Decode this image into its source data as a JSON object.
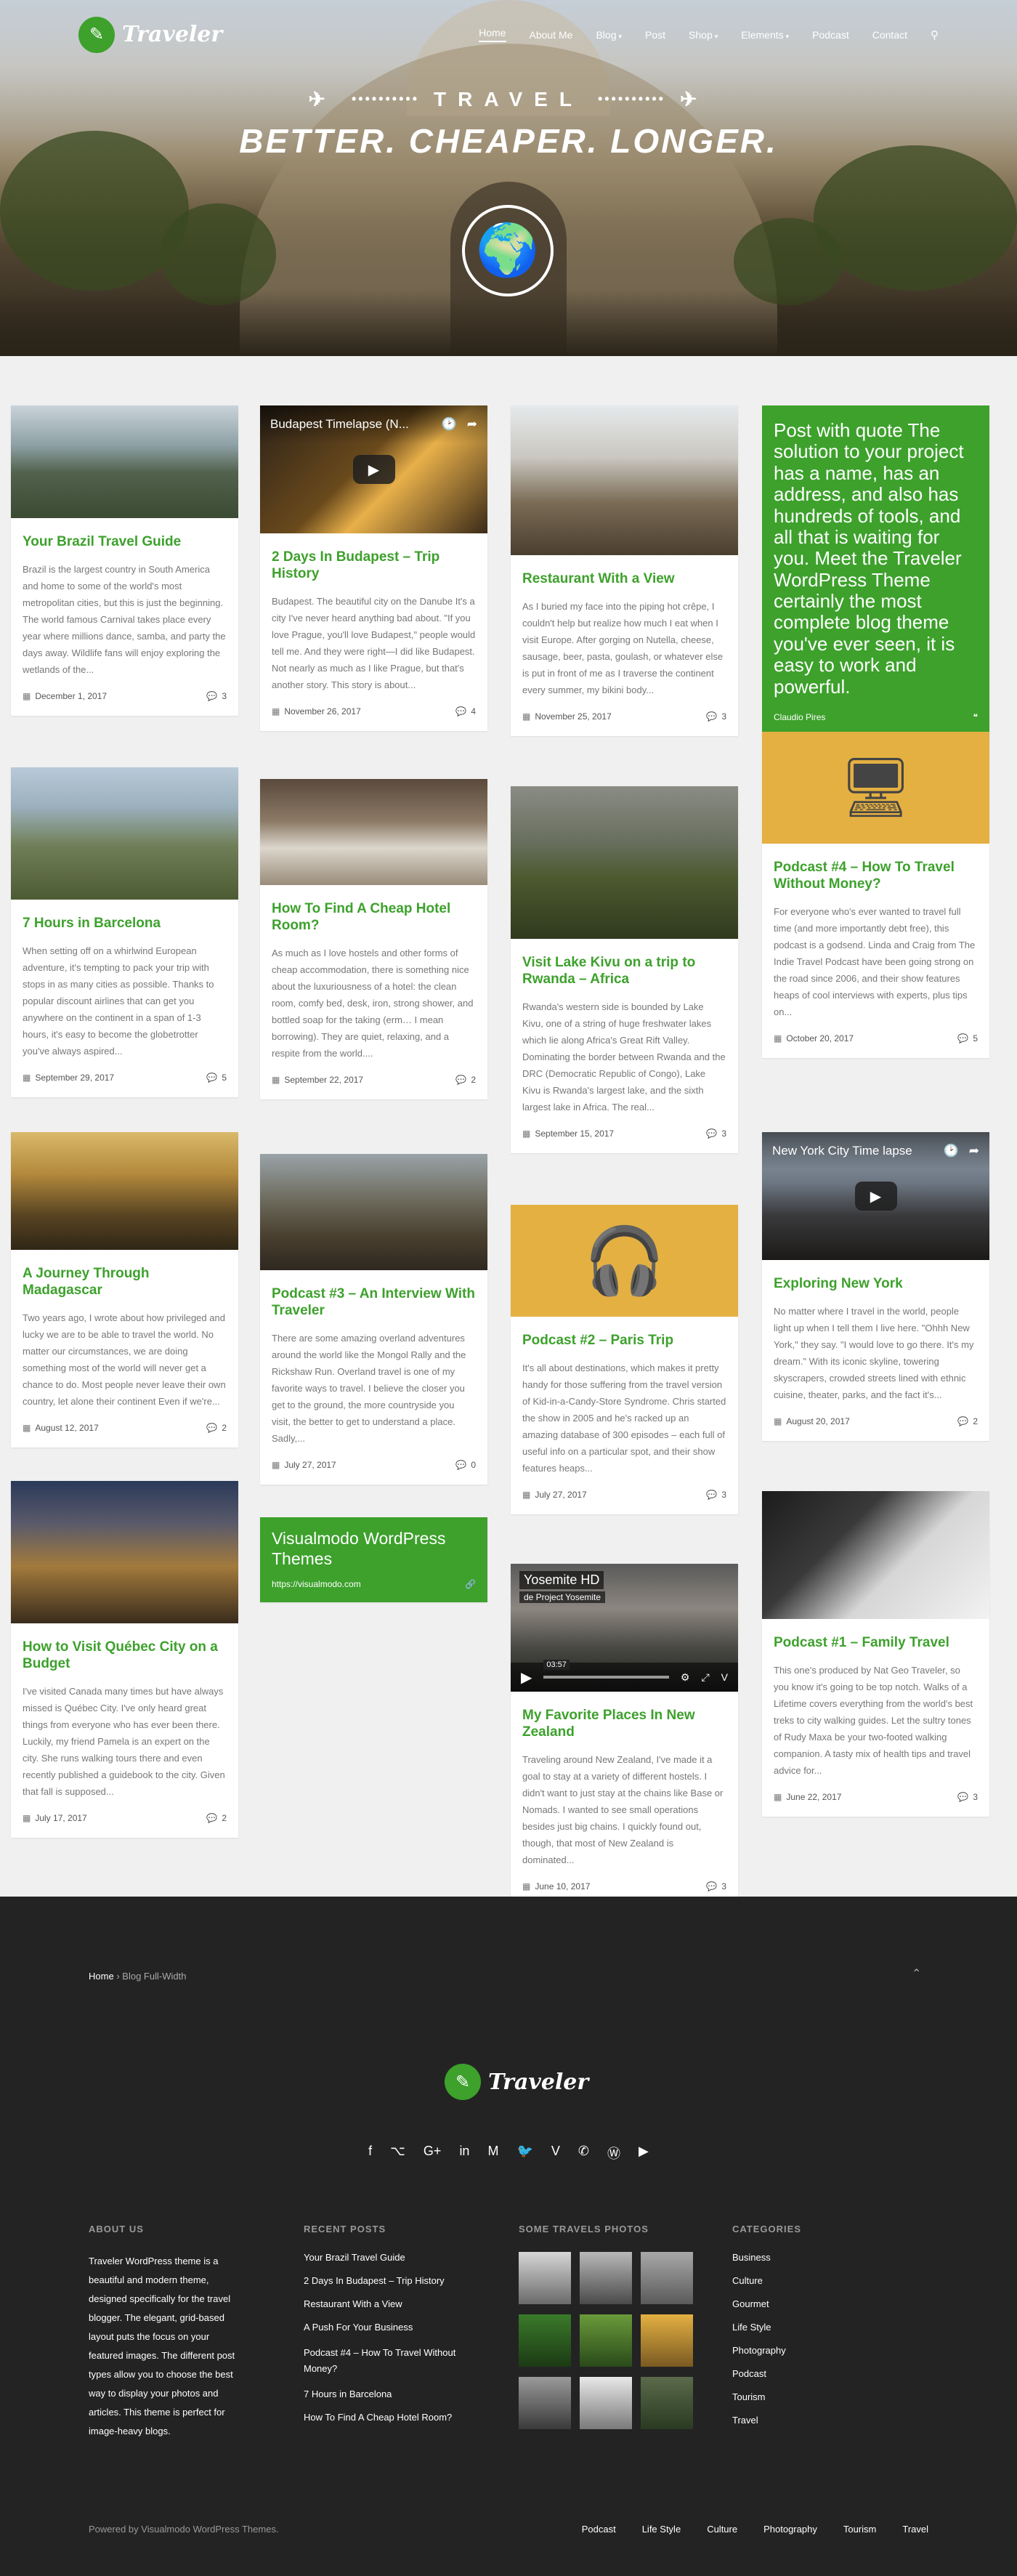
{
  "site": {
    "logo_text": "Traveler",
    "accent": "#3da12c"
  },
  "nav": {
    "items": [
      {
        "label": "Home",
        "active": true,
        "dropdown": false
      },
      {
        "label": "About Me",
        "active": false,
        "dropdown": false
      },
      {
        "label": "Blog",
        "active": false,
        "dropdown": true
      },
      {
        "label": "Post",
        "active": false,
        "dropdown": false
      },
      {
        "label": "Shop",
        "active": false,
        "dropdown": true
      },
      {
        "label": "Elements",
        "active": false,
        "dropdown": true
      },
      {
        "label": "Podcast",
        "active": false,
        "dropdown": false
      },
      {
        "label": "Contact",
        "active": false,
        "dropdown": false
      }
    ],
    "search_icon": "search-icon"
  },
  "hero": {
    "line1": "TRAVEL",
    "line2": "BETTER. CHEAPER. LONGER."
  },
  "posts": {
    "brazil": {
      "title": "Your Brazil Travel Guide",
      "excerpt": "Brazil is the largest country in South America and home to some of the world's most metropolitan cities, but this is just the beginning. The world famous Carnival takes place every year where millions dance, samba, and party the days away. Wildlife fans will enjoy exploring the wetlands of the...",
      "date": "December 1, 2017",
      "comments": "3"
    },
    "budapest": {
      "video_title": "Budapest Timelapse (N...",
      "title": "2 Days In Budapest – Trip History",
      "excerpt": "Budapest. The beautiful city on the Danube It's a city I've never heard anything bad about. \"If you love Prague, you'll love Budapest,\" people would tell me. And they were right—I did like Budapest. Not nearly as much as I like Prague, but that's another story. This story is about...",
      "date": "November 26, 2017",
      "comments": "4"
    },
    "restaurant": {
      "title": "Restaurant With a View",
      "excerpt": "As I buried my face into the piping hot crêpe, I couldn't help but realize how much I eat when I visit Europe. After gorging on Nutella, cheese, sausage, beer, pasta, goulash, or whatever else is put in front of me as I traverse the continent every summer, my bikini body...",
      "date": "November 25, 2017",
      "comments": "3"
    },
    "quote": {
      "text": "Post with quote The solution to your project has a name, has an address, and also has hundreds of tools, and all that is waiting for you. Meet the Traveler WordPress Theme certainly the most complete blog theme you've ever seen, it is easy to work and powerful.",
      "author": "Claudio Pires"
    },
    "barcelona": {
      "title": "7 Hours in Barcelona",
      "excerpt": "When setting off on a whirlwind European adventure, it's tempting to pack your trip with stops in as many cities as possible. Thanks to popular discount airlines that can get you anywhere on the continent in a span of 1-3 hours, it's easy to become the globetrotter you've always aspired...",
      "date": "September 29, 2017",
      "comments": "5"
    },
    "hotel": {
      "title": "How To Find A Cheap Hotel Room?",
      "excerpt": "As much as I love hostels and other forms of cheap accommodation, there is something nice about the luxuriousness of a hotel: the clean room, comfy bed, desk, iron, strong shower, and bottled soap for the taking (erm… I mean borrowing). They are quiet, relaxing, and a respite from the world....",
      "date": "September 22, 2017",
      "comments": "2"
    },
    "kivu": {
      "title": "Visit Lake Kivu on a trip to Rwanda – Africa",
      "excerpt": "Rwanda's western side is bounded by Lake Kivu, one of a string of huge freshwater lakes which lie along Africa's Great Rift Valley. Dominating the border between Rwanda and the DRC (Democratic Republic of Congo), Lake Kivu is Rwanda's largest lake, and the sixth largest lake in Africa. The real...",
      "date": "September 15, 2017",
      "comments": "3"
    },
    "podcast4": {
      "title": "Podcast #4 – How To Travel Without Money?",
      "excerpt": "For everyone who's ever wanted to travel full time (and more importantly debt free), this podcast is a godsend. Linda and Craig from The Indie Travel Podcast have been going strong on the road since 2006, and their show features heaps of cool interviews with experts, plus tips on...",
      "date": "October 20, 2017",
      "comments": "5"
    },
    "madagascar": {
      "title": "A Journey Through Madagascar",
      "excerpt": "Two years ago, I wrote about how privileged and lucky we are to be able to travel the world. No matter our circumstances, we are doing something most of the world will never get a chance to do. Most people never leave their own country, let alone their continent Even if we're...",
      "date": "August 12, 2017",
      "comments": "2"
    },
    "podcast3": {
      "title": "Podcast #3 – An Interview With Traveler",
      "excerpt": "There are some amazing overland adventures around the world like the Mongol Rally and the Rickshaw Run. Overland travel is one of my favorite ways to travel. I believe the closer you get to the ground, the more countryside you visit, the better to get to understand a place. Sadly,...",
      "date": "July 27, 2017",
      "comments": "0"
    },
    "podcast2": {
      "title": "Podcast #2 – Paris Trip",
      "excerpt": "It's all about destinations, which makes it pretty handy for those suffering from the travel version of Kid-in-a-Candy-Store Syndrome. Chris started the show in 2005 and he's racked up an amazing database of 300 episodes – each full of useful info on a particular spot, and their show features heaps...",
      "date": "July 27, 2017",
      "comments": "3"
    },
    "newyork": {
      "video_title": "New York City Time lapse",
      "title": "Exploring New York",
      "excerpt": "No matter where I travel in the world, people light up when I tell them I live here. \"Ohhh New York,\" they say. \"I would love to go there. It's my dream.\" With its iconic skyline, towering skyscrapers, crowded streets lined with ethnic cuisine, theater, parks, and the fact it's...",
      "date": "August 20, 2017",
      "comments": "2"
    },
    "quebec": {
      "title": "How to Visit Québec City on a Budget",
      "excerpt": "I've visited Canada many times but have always missed is Québec City. I've only heard great things from everyone who has ever been there. Luckily, my friend Pamela is an expert on the city. She runs walking tours there and even recently published a guidebook to the city. Given that fall is supposed...",
      "date": "July 17, 2017",
      "comments": "2"
    },
    "link": {
      "title": "Visualmodo WordPress Themes",
      "url": "https://visualmodo.com"
    },
    "newzealand": {
      "video_title": "Yosemite HD",
      "video_channel": "de Project Yosemite",
      "video_time": "03:57",
      "title": "My Favorite Places In New Zealand",
      "excerpt": "Traveling around New Zealand, I've made it a goal to stay at a variety of different hostels. I didn't want to just stay at the chains like Base or Nomads. I wanted to see small operations besides just big chains. I quickly found out, though, that most of New Zealand is dominated...",
      "date": "June 10, 2017",
      "comments": "3"
    },
    "podcast1": {
      "title": "Podcast #1 – Family Travel",
      "excerpt": "This one's produced by Nat Geo Traveler, so you know it's going to be top notch. Walks of a Lifetime covers everything from the world's best treks to city walking guides. Let the sultry tones of Rudy Maxa be your two-footed walking companion. A tasty mix of health tips and travel advice for...",
      "date": "June 22, 2017",
      "comments": "3"
    }
  },
  "footer": {
    "breadcrumb_home": "Home",
    "breadcrumb_sep": "›",
    "breadcrumb_current": "Blog Full-Width",
    "socials": [
      "facebook-icon",
      "github-icon",
      "google-plus-icon",
      "linkedin-icon",
      "mixcloud-icon",
      "twitter-icon",
      "vimeo-icon",
      "whatsapp-icon",
      "wordpress-icon",
      "youtube-icon"
    ],
    "about_title": "ABOUT US",
    "about_text": "Traveler WordPress theme is a beautiful and modern theme, designed specifically for the travel blogger. The elegant, grid-based layout puts the focus on your featured images. The different post types allow you to choose the best way to display your photos and articles. This theme is perfect for image-heavy blogs.",
    "recent_title": "RECENT POSTS",
    "recent": [
      "Your Brazil Travel Guide",
      "2 Days In Budapest – Trip History",
      "Restaurant With a View",
      "A Push For Your Business",
      "Podcast #4 – How To Travel Without Money?",
      "7 Hours in Barcelona",
      "How To Find A Cheap Hotel Room?"
    ],
    "photos_title": "SOME TRAVELS PHOTOS",
    "categories_title": "CATEGORIES",
    "categories": [
      "Business",
      "Culture",
      "Gourmet",
      "Life Style",
      "Photography",
      "Podcast",
      "Tourism",
      "Travel"
    ],
    "powered": "Powered by Visualmodo WordPress Themes.",
    "bottom_nav": [
      "Podcast",
      "Life Style",
      "Culture",
      "Photography",
      "Tourism",
      "Travel"
    ]
  }
}
